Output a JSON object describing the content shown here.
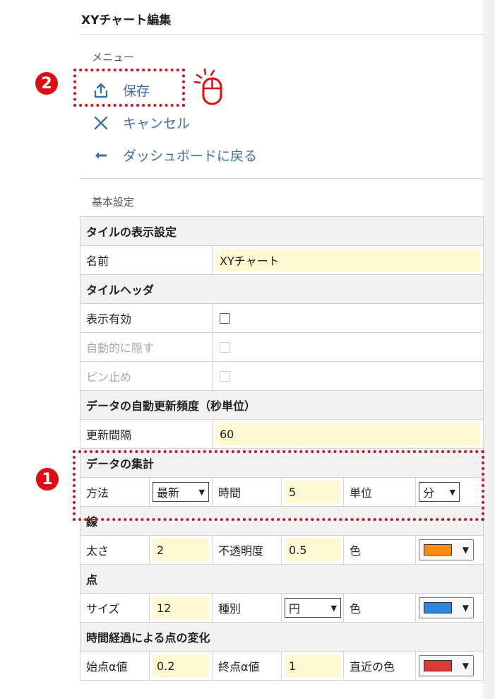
{
  "header": {
    "title": "XYチャート編集"
  },
  "menu": {
    "caption": "メニュー",
    "items": [
      {
        "label": "保存",
        "icon": "upload-icon"
      },
      {
        "label": "キャンセル",
        "icon": "close-icon"
      },
      {
        "label": "ダッシュボードに戻る",
        "icon": "back-arrow-icon"
      }
    ]
  },
  "basic": {
    "caption": "基本設定",
    "tile_display": {
      "header": "タイルの表示設定",
      "name_label": "名前",
      "name_value": "XYチャート"
    },
    "tile_header": {
      "header": "タイルヘッダ",
      "display_label": "表示有効",
      "autohide_label": "自動的に隠す",
      "pin_label": "ピン止め"
    },
    "refresh": {
      "header": "データの自動更新頻度（秒単位）",
      "interval_label": "更新間隔",
      "interval_value": "60"
    },
    "aggregate": {
      "header": "データの集計",
      "method_label": "方法",
      "method_value": "最新",
      "time_label": "時間",
      "time_value": "5",
      "unit_label": "単位",
      "unit_value": "分"
    },
    "line": {
      "header": "線",
      "width_label": "太さ",
      "width_value": "2",
      "opacity_label": "不透明度",
      "opacity_value": "0.5",
      "color_label": "色",
      "color": "#f78c12"
    },
    "point": {
      "header": "点",
      "size_label": "サイズ",
      "size_value": "12",
      "kind_label": "種別",
      "kind_value": "円",
      "color_label": "色",
      "color": "#2a86e0"
    },
    "time_change": {
      "header": "時間経過による点の変化",
      "start_alpha_label": "始点α値",
      "start_alpha_value": "0.2",
      "end_alpha_label": "終点α値",
      "end_alpha_value": "1",
      "recent_color_label": "直近の色",
      "recent_color": "#e03838"
    }
  },
  "annotations": {
    "badge1": "1",
    "badge2": "2"
  }
}
